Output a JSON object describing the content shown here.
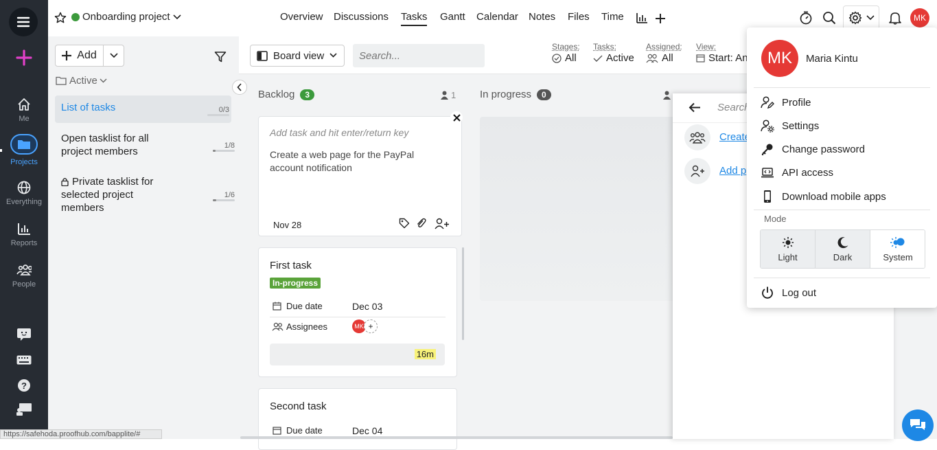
{
  "nav": {
    "items": [
      {
        "label": "Me",
        "icon": "home-icon"
      },
      {
        "label": "Projects",
        "icon": "folder-icon"
      },
      {
        "label": "Everything",
        "icon": "globe-icon"
      },
      {
        "label": "Reports",
        "icon": "bar-chart-icon"
      },
      {
        "label": "People",
        "icon": "people-icon"
      }
    ],
    "accent": "#e040c8"
  },
  "header": {
    "project_name": "Onboarding project",
    "status_color": "#3c9a3c",
    "tabs": [
      "Overview",
      "Discussions",
      "Tasks",
      "Gantt",
      "Calendar",
      "Notes",
      "Files",
      "Time"
    ],
    "active_tab": "Tasks",
    "avatar_initials": "MK",
    "avatar_color": "#e53935"
  },
  "lists_panel": {
    "add_label": "Add",
    "filter_label": "Active",
    "lists": [
      {
        "name": "List of tasks",
        "count": "0/3",
        "progress": 0
      },
      {
        "name": "Open tasklist for all project members",
        "count": "1/8",
        "progress": 0.125
      },
      {
        "name": "Private tasklist for selected project members",
        "count": "1/6",
        "progress": 0.167
      }
    ]
  },
  "toolbar": {
    "view_label": "Board view",
    "search_placeholder": "Search...",
    "filters": [
      {
        "label": "Stages:",
        "value": "All"
      },
      {
        "label": "Tasks:",
        "value": "Active"
      },
      {
        "label": "Assigned:",
        "value": "All"
      },
      {
        "label": "View:",
        "value": "Start: An"
      }
    ]
  },
  "board": {
    "stages": [
      {
        "name": "Backlog",
        "count": "3",
        "members": "1"
      },
      {
        "name": "In progress",
        "count": "0"
      }
    ],
    "new_task": {
      "placeholder": "Add task and hit enter/return key",
      "text": "Create a web page for the PayPal account notification",
      "date": "Nov 28"
    },
    "cards": [
      {
        "title": "First task",
        "status": "In-progress",
        "due_label": "Due date",
        "due": "Dec 03",
        "assignees_label": "Assignees",
        "assignee": "MK",
        "time": "16m"
      },
      {
        "title": "Second task",
        "due_label": "Due date",
        "due": "Dec 04"
      }
    ]
  },
  "side_panel": {
    "search_placeholder": "Search",
    "links": [
      "Create",
      "Add p"
    ]
  },
  "user_menu": {
    "name": "Maria Kintu",
    "initials": "MK",
    "items": [
      {
        "label": "Profile",
        "icon": "user-edit-icon"
      },
      {
        "label": "Settings",
        "icon": "user-gear-icon"
      },
      {
        "label": "Change password",
        "icon": "key-icon"
      },
      {
        "label": "API access",
        "icon": "laptop-icon"
      },
      {
        "label": "Download mobile apps",
        "icon": "phone-icon"
      }
    ],
    "mode_label": "Mode",
    "modes": [
      "Light",
      "Dark",
      "System"
    ],
    "selected_mode": "System",
    "logout_label": "Log out"
  },
  "status_url": "https://safehoda.proofhub.com/bapplite/#"
}
